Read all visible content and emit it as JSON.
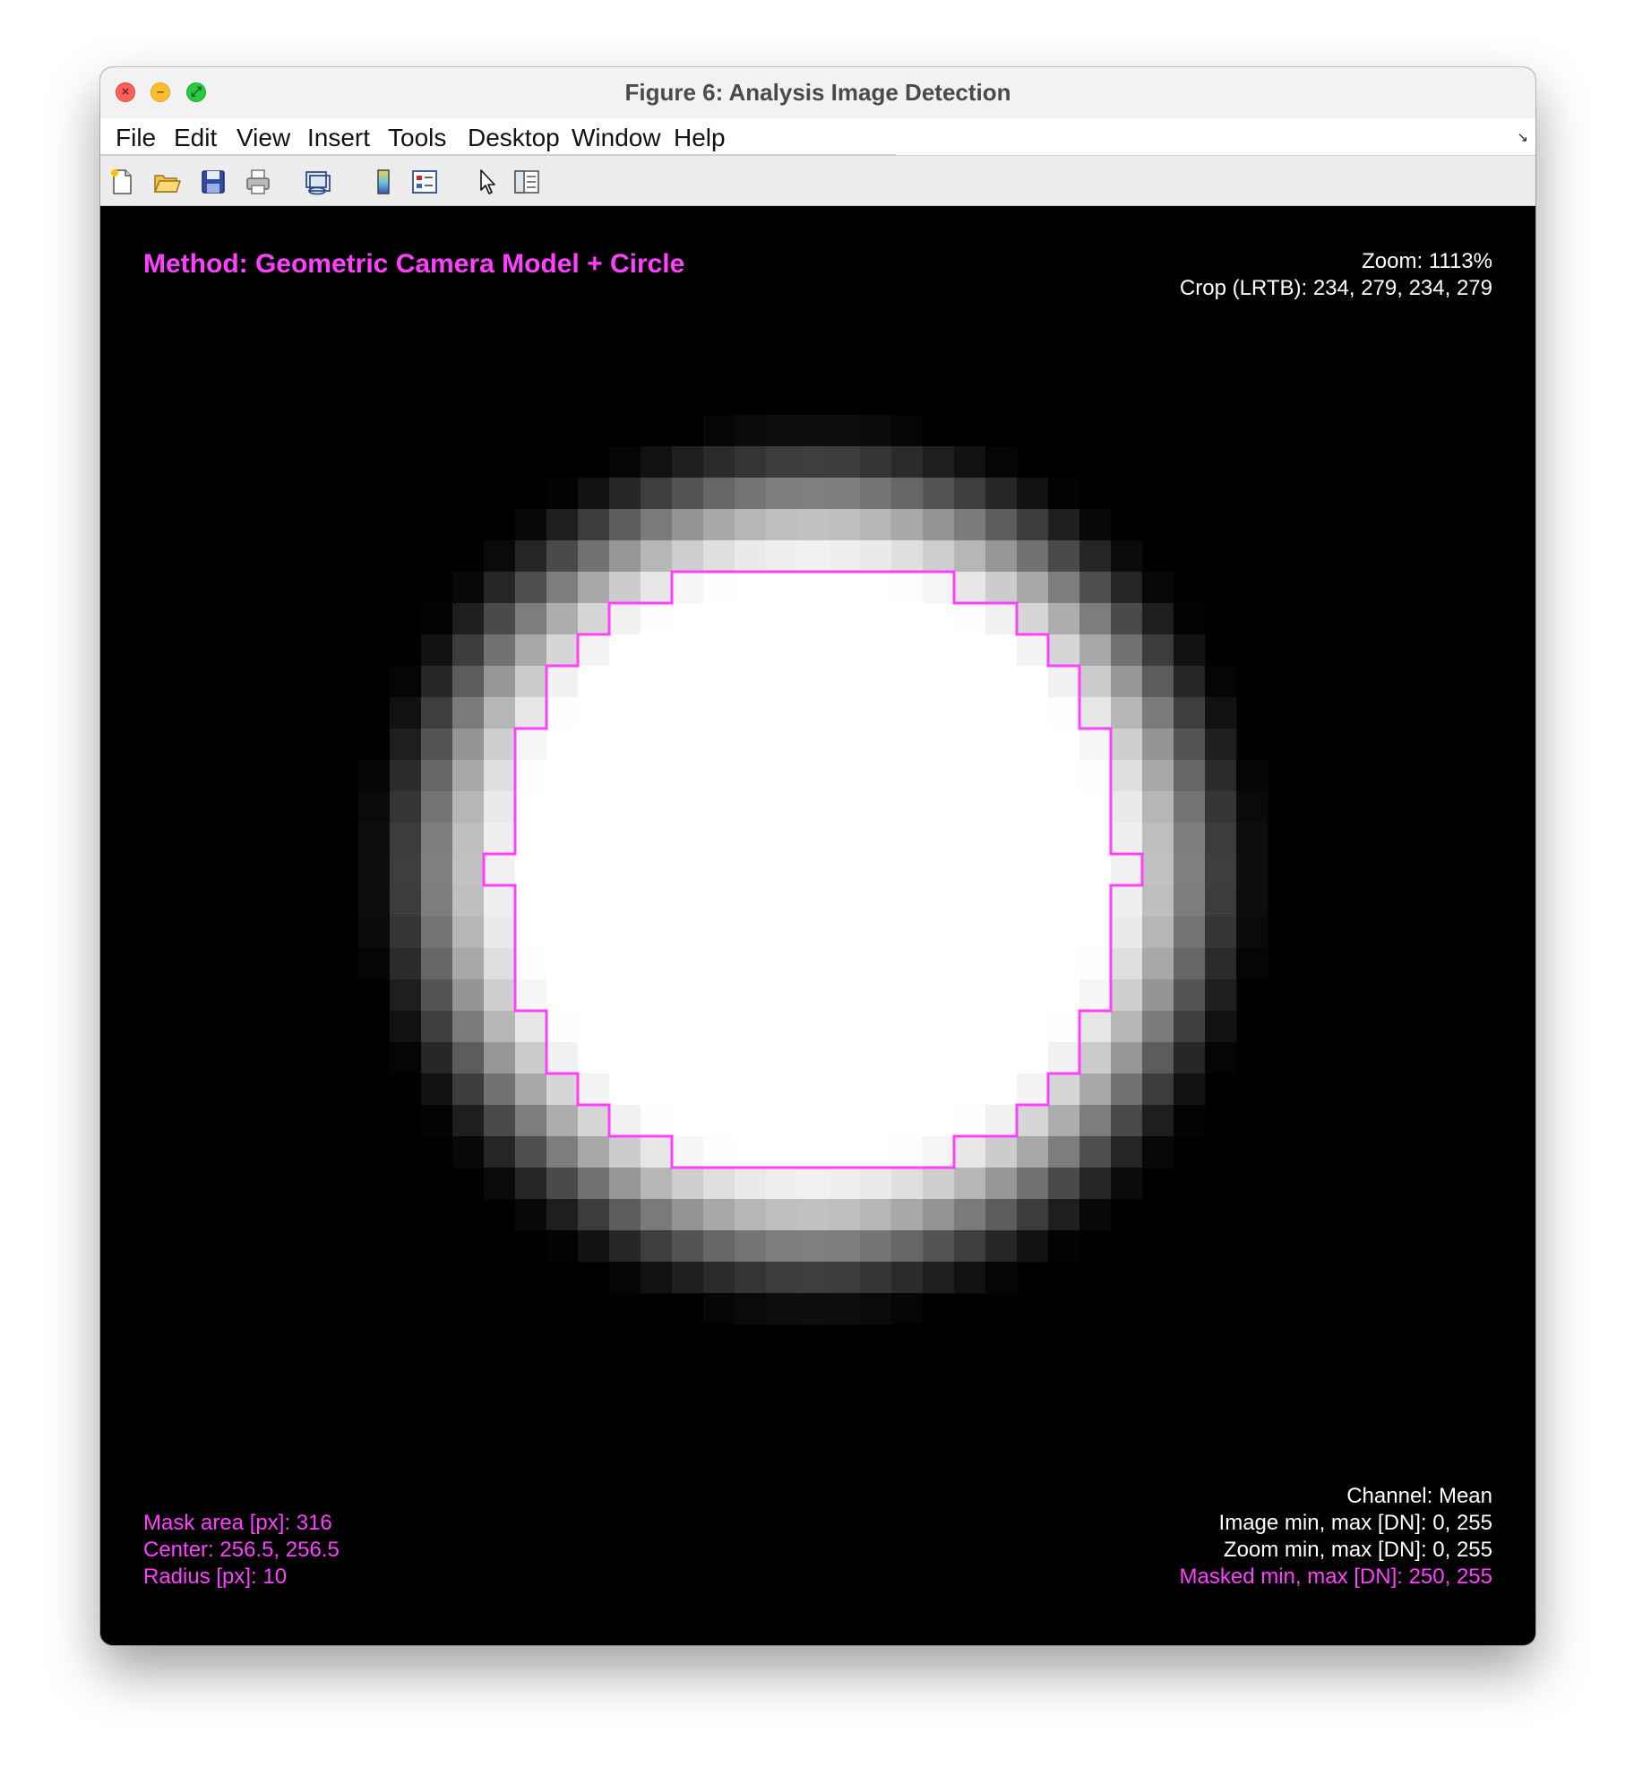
{
  "window": {
    "title": "Figure 6: Analysis Image Detection"
  },
  "menu": [
    "File",
    "Edit",
    "View",
    "Insert",
    "Tools",
    "Desktop",
    "Window",
    "Help"
  ],
  "toolbar": {
    "buttons": [
      "new-figure-icon",
      "open-file-icon",
      "save-icon",
      "print-icon",
      "link-icon",
      "colorbar-icon",
      "legend-icon",
      "pointer-icon",
      "property-editor-icon"
    ]
  },
  "overlay": {
    "method": "Method: Geometric Camera Model + Circle",
    "zoom": "Zoom: 1113%",
    "crop": "Crop (LRTB): 234, 279, 234, 279",
    "mask_area": "Mask area [px]: 316",
    "center": "Center: 256.5, 256.5",
    "radius": "Radius [px]: 10",
    "channel": "Channel: Mean",
    "image_minmax": "Image min, max [DN]: 0, 255",
    "zoom_minmax": "Zoom min, max [DN]: 0, 255",
    "masked_minmax": "Masked min, max [DN]: 250, 255"
  },
  "image": {
    "grid_cols": 29,
    "grid_rows": 29,
    "intensity_min": 0,
    "intensity_max": 255,
    "mask_color": "#ff40ff"
  }
}
